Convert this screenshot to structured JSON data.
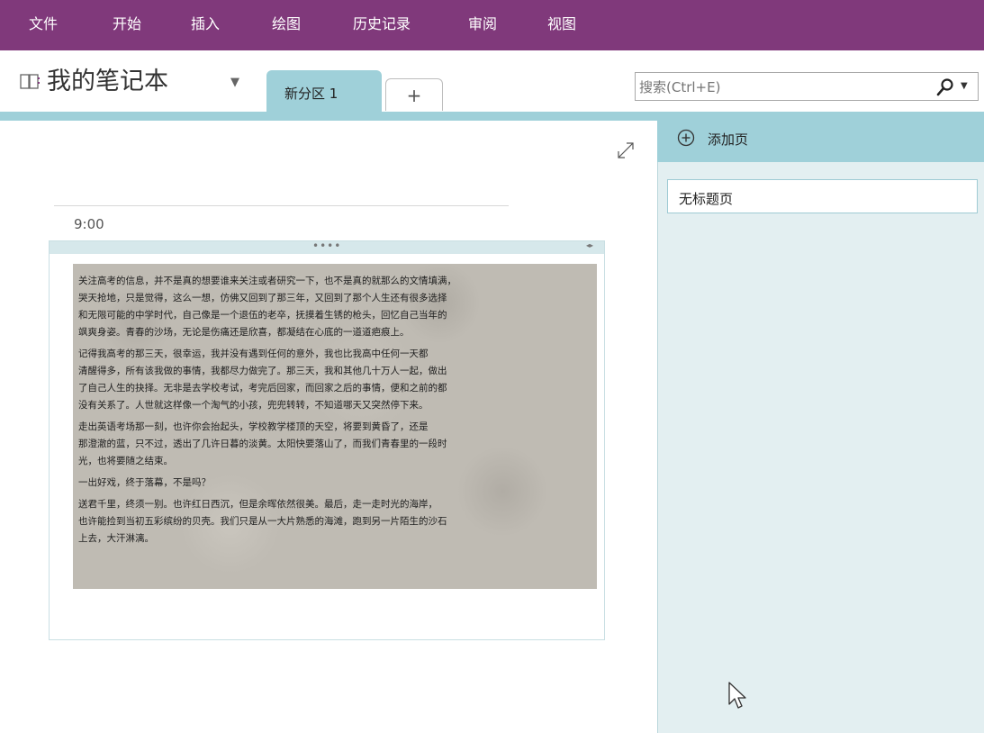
{
  "menu": {
    "items": [
      "文件",
      "开始",
      "插入",
      "绘图",
      "历史记录",
      "审阅",
      "视图"
    ]
  },
  "notebook": {
    "title": "我的笔记本"
  },
  "sections": {
    "tabs": [
      "新分区 1"
    ],
    "add_symbol": "+"
  },
  "search": {
    "placeholder": "搜索(Ctrl+E)"
  },
  "page": {
    "time": "9:00",
    "container_handle": "••••",
    "container_arrows": "◂▸",
    "image_text_lines": [
      "关注高考的信息，并不是真的想要谁来关注或者研究一下，也不是真的就那么的文情填满，",
      "哭天抢地，只是觉得，这么一想，仿佛又回到了那三年，又回到了那个人生还有很多选择",
      "和无限可能的中学时代，自己像是一个退伍的老卒，抚摸着生锈的枪头，回忆自己当年的",
      "飒爽身姿。青春的沙场，无论是伤痛还是欣喜，都凝结在心底的一道道疤痕上。",
      "    记得我高考的那三天，很幸运，我并没有遇到任何的意外，我也比我高中任何一天都",
      "清醒得多，所有该我做的事情，我都尽力做完了。那三天，我和其他几十万人一起，做出",
      "了自己人生的抉择。无非是去学校考试，考完后回家，而回家之后的事情，便和之前的都",
      "没有关系了。人世就这样像一个淘气的小孩，兜兜转转，不知道哪天又突然停下来。",
      "    走出英语考场那一刻，也许你会抬起头，学校教学楼顶的天空，将要到黄昏了，还是",
      "那澄澈的蓝，只不过，透出了几许日暮的淡黄。太阳快要落山了，而我们青春里的一段时",
      "光，也将要随之结束。",
      "    一出好戏，终于落幕，不是吗？",
      "    送君千里，终须一别。也许红日西沉，但是余晖依然很美。最后，走一走时光的海岸，",
      "也许能捡到当初五彩缤纷的贝壳。我们只是从一大片熟悉的海滩，跑到另一片陌生的沙石",
      "上去，大汗淋漓。"
    ]
  },
  "pages_pane": {
    "add_page_label": "添加页",
    "pages": [
      "无标题页"
    ]
  },
  "colors": {
    "ribbon": "#80397b",
    "section_tab": "#9fd0d9",
    "pane_background": "#e3eff1"
  }
}
